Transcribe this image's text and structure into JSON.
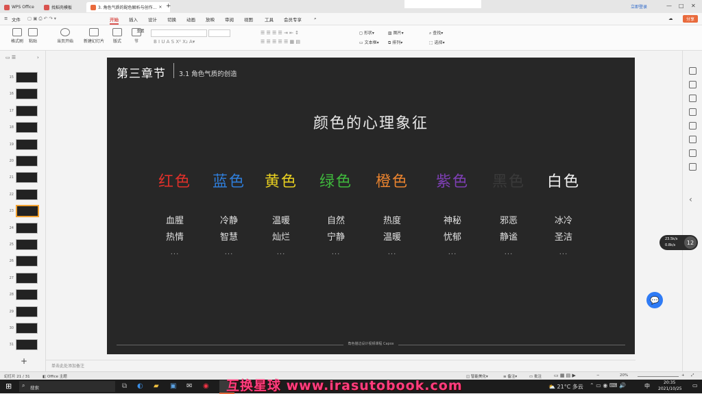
{
  "window": {
    "tabs": [
      {
        "label": "WPS Office",
        "color": "#d9534f"
      },
      {
        "label": "找稻壳模板",
        "color": "#d9534f"
      },
      {
        "label": "3. 角色气质的配色解析与创作...",
        "color": "#e96a3c"
      }
    ],
    "login_label": "立即登录"
  },
  "menu": {
    "file": "文件",
    "items": [
      "开始",
      "插入",
      "设计",
      "切换",
      "动画",
      "放映",
      "审阅",
      "视图",
      "工具",
      "会员专享"
    ],
    "active": "开始",
    "share": "分享"
  },
  "ribbon": {
    "buttons": [
      "格式刷",
      "粘贴",
      "当页开始",
      "新建幻灯片",
      "版式",
      "节",
      "重置"
    ],
    "right": [
      "形状",
      "图片",
      "查找",
      "文本框",
      "排列",
      "选择"
    ]
  },
  "thumbnails": [
    {
      "num": "15"
    },
    {
      "num": "16"
    },
    {
      "num": "17"
    },
    {
      "num": "18"
    },
    {
      "num": "19"
    },
    {
      "num": "20"
    },
    {
      "num": "21"
    },
    {
      "num": "22"
    },
    {
      "num": "23",
      "selected": true
    },
    {
      "num": "24"
    },
    {
      "num": "25"
    },
    {
      "num": "26"
    },
    {
      "num": "27"
    },
    {
      "num": "28"
    },
    {
      "num": "29"
    },
    {
      "num": "30"
    },
    {
      "num": "31"
    }
  ],
  "slide": {
    "chapter": "第三章节",
    "section": "3.1 角色气质的创造",
    "heading": "颜色的心理象征",
    "colors": [
      {
        "name": "红色",
        "color": "#e0302a",
        "word1": "血腥",
        "word2": "热情",
        "dots": "..."
      },
      {
        "name": "蓝色",
        "color": "#2f7dd8",
        "word1": "冷静",
        "word2": "智慧",
        "dots": "..."
      },
      {
        "name": "黄色",
        "color": "#e8d020",
        "word1": "温暖",
        "word2": "灿烂",
        "dots": "..."
      },
      {
        "name": "绿色",
        "color": "#3fb83c",
        "word1": "自然",
        "word2": "宁静",
        "dots": "..."
      },
      {
        "name": "橙色",
        "color": "#e9832f",
        "word1": "热度",
        "word2": "温暖",
        "dots": "..."
      },
      {
        "name": "紫色",
        "color": "#7e3fb4",
        "word1": "神秘",
        "word2": "忧郁",
        "dots": "..."
      },
      {
        "name": "黑色",
        "color": "#3a3a3a",
        "word1": "邪恶",
        "word2": "静谧",
        "dots": "..."
      },
      {
        "name": "白色",
        "color": "#f2f2f2",
        "word1": "冰冷",
        "word2": "圣洁",
        "dots": "..."
      }
    ],
    "footer": "角色描边设计视频课程 Capox"
  },
  "notes_placeholder": "单击此处添加备注",
  "status": {
    "slide_count": "幻灯片 21 / 31",
    "theme": "Office 主题",
    "smart_beautify": "智能美化",
    "notes": "备注",
    "comment": "批注",
    "zoom": "20%"
  },
  "taskbar": {
    "search": "搜索",
    "weather": "21°C 多云",
    "time": "20:35",
    "date": "2021/10/25",
    "ime": "中"
  },
  "watermark": "互换星球 www.irasutobook.com",
  "net_widget": {
    "up": "23.5k/s",
    "down": "0.8k/s",
    "percent": "12"
  }
}
